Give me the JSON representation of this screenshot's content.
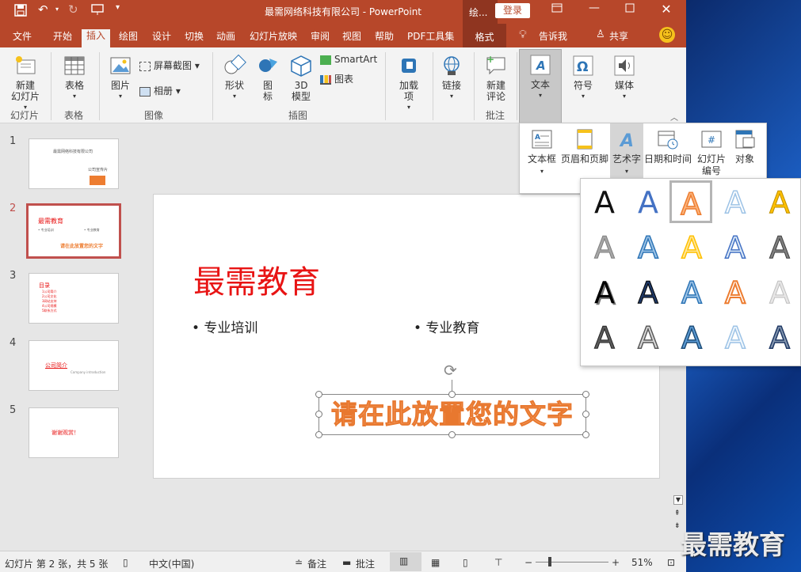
{
  "window": {
    "title": "最需网络科技有限公司  -  PowerPoint",
    "context_title": "绘...",
    "login_label": "登录"
  },
  "tabs": [
    "文件",
    "开始",
    "插入",
    "绘图",
    "设计",
    "切换",
    "动画",
    "幻灯片放映",
    "审阅",
    "视图",
    "帮助",
    "PDF工具集",
    "格式"
  ],
  "tell_me": "告诉我",
  "share_label": "共享",
  "ribbon": {
    "new_slide": "新建\n幻灯片",
    "table": "表格",
    "picture": "图片",
    "screenshot": "屏幕截图",
    "album": "相册",
    "shapes": "形状",
    "icons": "图\n标",
    "model3d": "3D\n模型",
    "smartart": "SmartArt",
    "chart": "图表",
    "addins": "加载\n项",
    "link": "链接",
    "comment": "新建\n评论",
    "text": "文本",
    "symbol": "符号",
    "media": "媒体",
    "groups": {
      "slides": "幻灯片",
      "tables": "表格",
      "images": "图像",
      "illustrations": "插图",
      "comments": "批注"
    }
  },
  "text_dropdown": {
    "textbox": "文本框",
    "header_footer": "页眉和页脚",
    "wordart": "艺术字",
    "datetime": "日期和时间",
    "slide_number": "幻灯片\n编号",
    "object": "对象"
  },
  "thumbnails": [
    {
      "num": "1",
      "title": "最需网络科技有限公司",
      "sub": "公司宣传片"
    },
    {
      "num": "2",
      "title": "最需教育",
      "b1": "• 专业培训",
      "b2": "• 专业教育",
      "wordart": "请在此放置您的文字"
    },
    {
      "num": "3",
      "title": "目录",
      "lines": [
        "1公司简介",
        "2公司文化",
        "3网站支持",
        "4公司规模",
        "5联系方式"
      ]
    },
    {
      "num": "4",
      "title": "公司简介",
      "sub": "Company introduction"
    },
    {
      "num": "5",
      "title": "谢谢观赏！"
    }
  ],
  "slide": {
    "title": "最需教育",
    "bullet1": "• 专业培训",
    "bullet2": "• 专业教育",
    "wordart": "请在此放置您的文字"
  },
  "status": {
    "slide_info": "幻灯片 第 2 张，共 5 张",
    "language": "中文(中国)",
    "notes": "备注",
    "comments": "批注",
    "zoom": "51%"
  },
  "watermark": "最需教育",
  "colors": {
    "accent": "#b7472a",
    "slide_title": "#e81414",
    "wordart_fill": "#f7a36b"
  }
}
